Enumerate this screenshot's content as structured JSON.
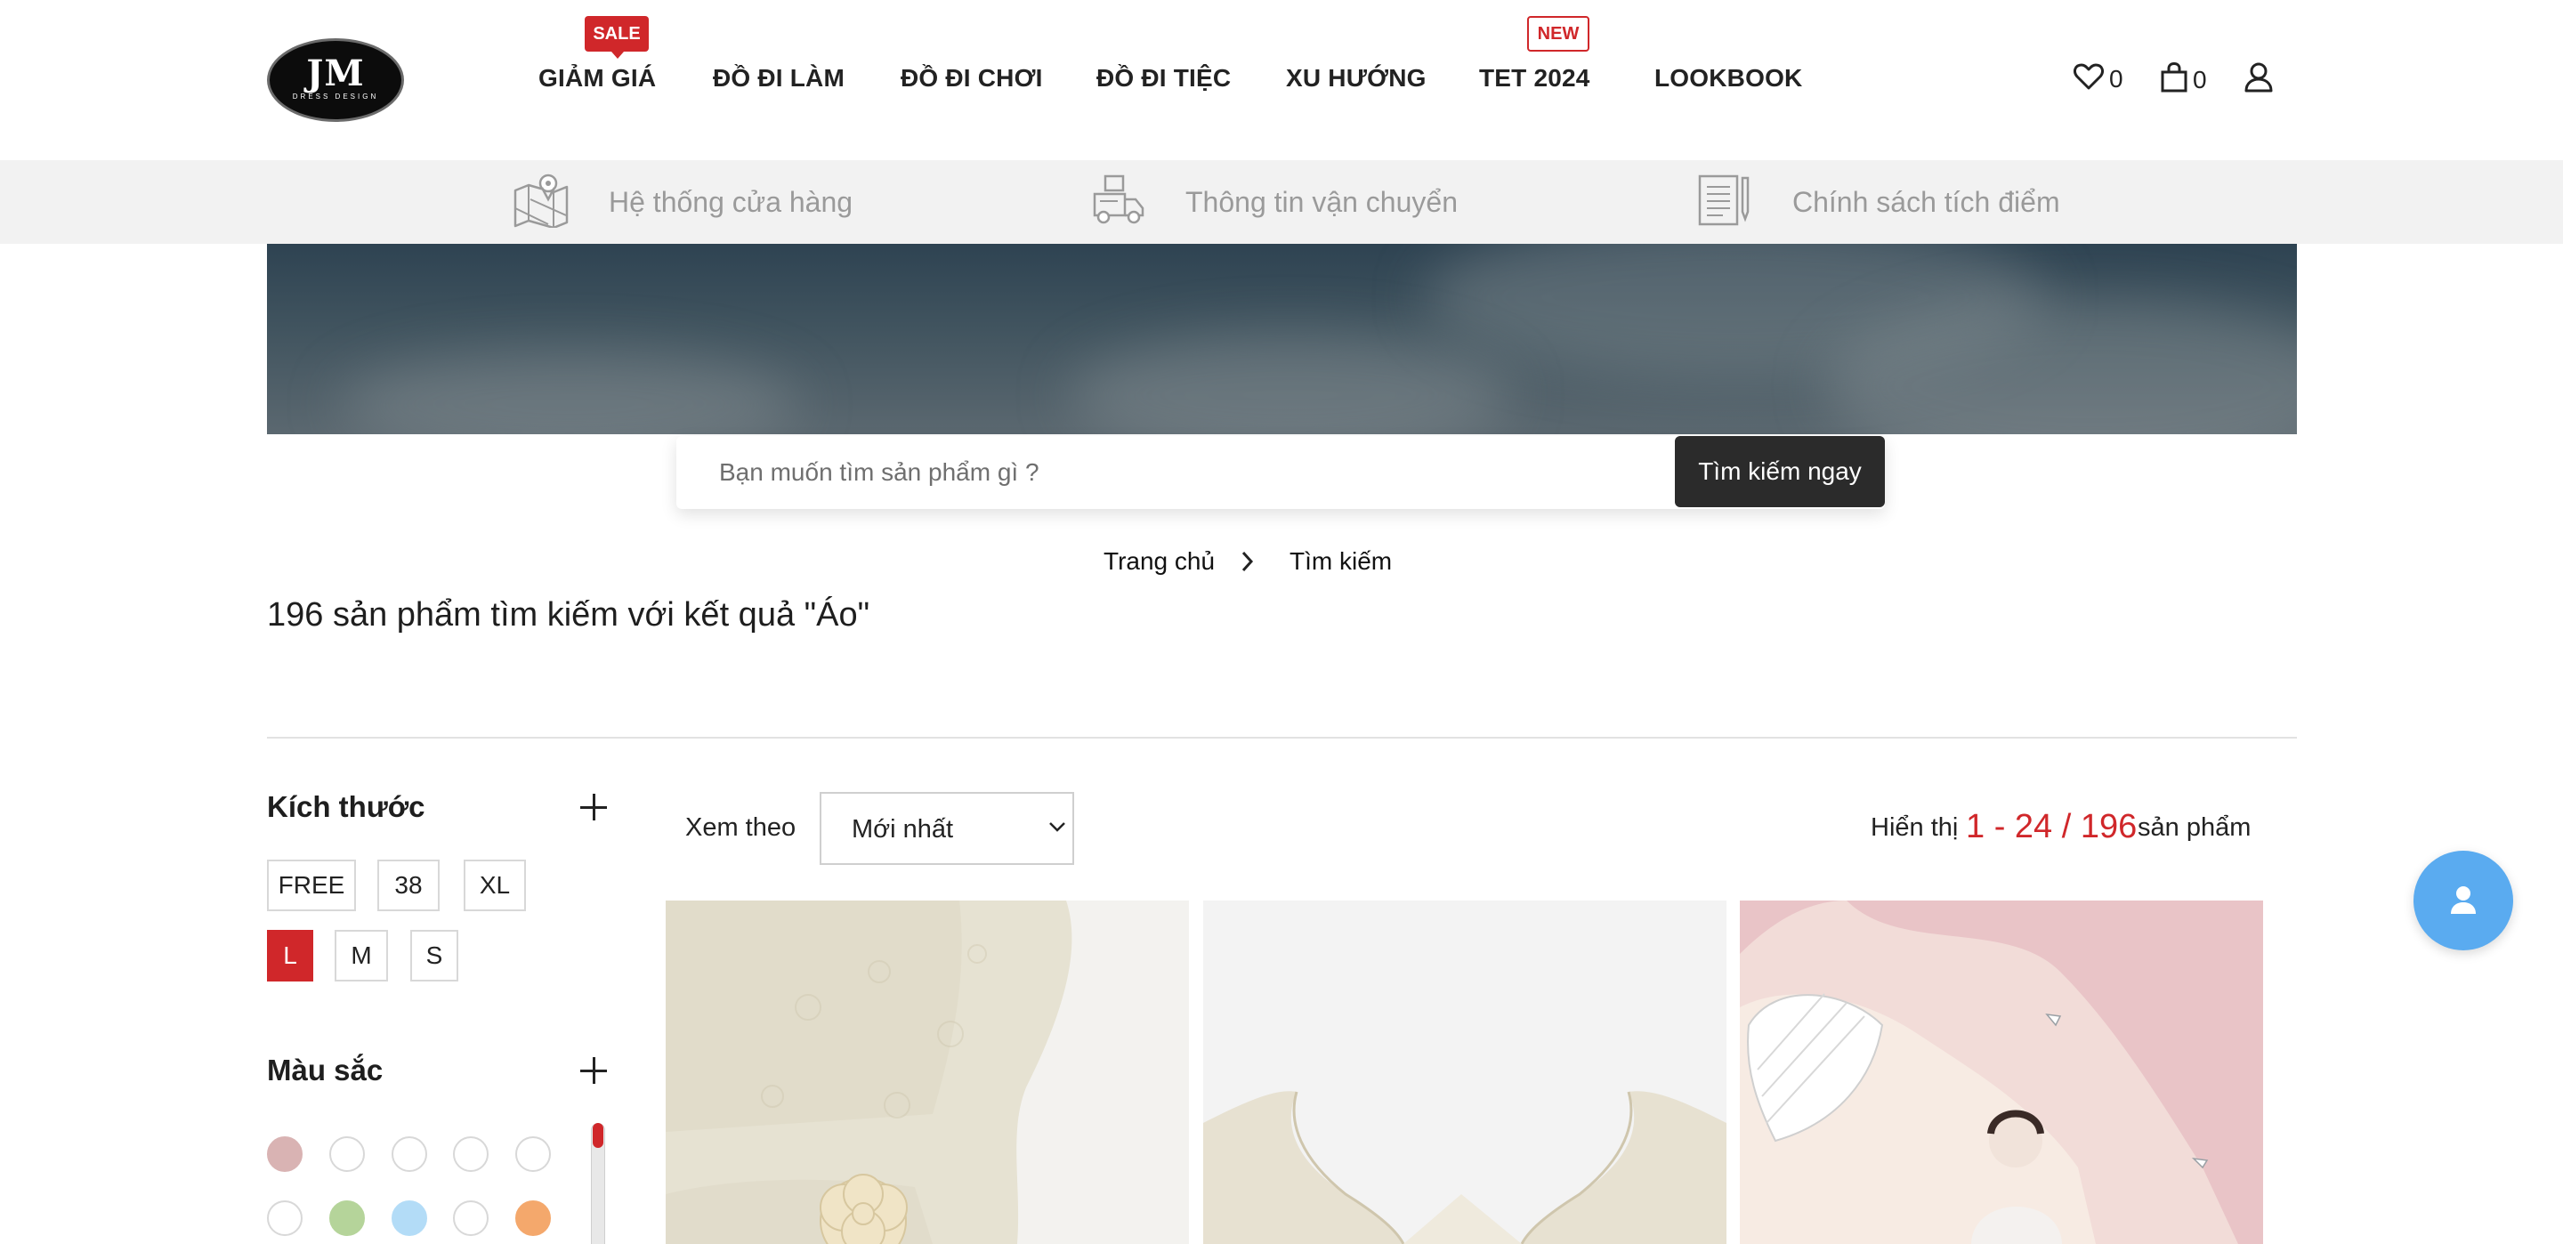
{
  "header": {
    "logo": {
      "main": "JM",
      "sub": "DRESS DESIGN"
    },
    "nav": [
      {
        "label": "GIẢM GIÁ"
      },
      {
        "label": "ĐỒ ĐI LÀM"
      },
      {
        "label": "ĐỒ ĐI CHƠI"
      },
      {
        "label": "ĐỒ ĐI TIỆC"
      },
      {
        "label": "XU HƯỚNG"
      },
      {
        "label": "TET 2024"
      },
      {
        "label": "LOOKBOOK"
      }
    ],
    "badges": {
      "sale": "SALE",
      "new": "NEW"
    },
    "icons": {
      "wishlist": {
        "icon": "heart-icon",
        "count": "0"
      },
      "cart": {
        "icon": "shopping-bag-icon",
        "count": "0"
      },
      "account": {
        "icon": "user-icon"
      }
    }
  },
  "infobar": [
    {
      "icon": "store-map-icon",
      "label": "Hệ thống cửa hàng"
    },
    {
      "icon": "delivery-truck-icon",
      "label": "Thông tin vận chuyển"
    },
    {
      "icon": "policy-document-icon",
      "label": "Chính sách tích điểm"
    }
  ],
  "search": {
    "placeholder": "Bạn muốn tìm sản phẩm gì ?",
    "button_label": "Tìm kiếm ngay"
  },
  "breadcrumb": {
    "home": "Trang chủ",
    "current": "Tìm kiếm"
  },
  "result_title": "196 sản phẩm tìm kiếm với kết quả \"Áo\"",
  "filters": {
    "size": {
      "title": "Kích thước",
      "options": [
        "FREE",
        "38",
        "XL",
        "L",
        "M",
        "S"
      ],
      "selected": "L"
    },
    "color": {
      "title": "Màu sắc",
      "swatches": [
        "#d9b3b3",
        "#ffffff",
        "#ffffff",
        "#ffffff",
        "#ffffff",
        "#ffffff",
        "#b5d49a",
        "#b3dcf7",
        "#ffffff",
        "#f4a86c"
      ]
    }
  },
  "toolbar": {
    "sort_label": "Xem theo",
    "sort_value": "Mới nhất",
    "showing_prefix": "Hiển thị",
    "showing_range": "1 - 24 / 196",
    "showing_suffix": "sản phẩm"
  },
  "colors": {
    "accent_red": "#d0272a",
    "dark_button": "#2b2b2b",
    "infobar_bg": "#f2f2f2",
    "fab_blue": "#5aabf0"
  },
  "fab": {
    "icon": "user-icon"
  }
}
